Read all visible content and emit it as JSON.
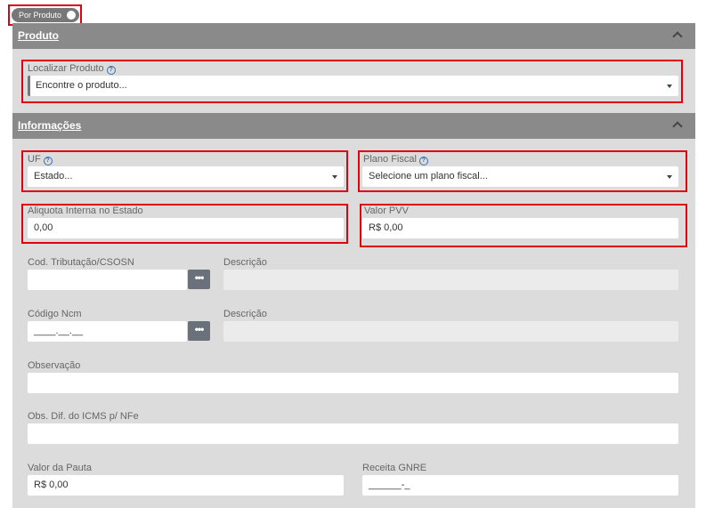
{
  "toggle": {
    "label": "Por Produto"
  },
  "produto": {
    "header": "Produto",
    "localizar_label": "Localizar Produto",
    "localizar_placeholder": "Encontre o produto..."
  },
  "informacoes": {
    "header": "Informações",
    "uf_label": "UF",
    "uf_value": "Estado...",
    "plano_fiscal_label": "Plano Fiscal",
    "plano_fiscal_value": "Selecione um plano fiscal...",
    "aliquota_label": "Aliquota Interna no Estado",
    "aliquota_value": "0,00",
    "valor_pvv_label": "Valor PVV",
    "valor_pvv_value": "R$ 0,00",
    "cod_tributacao_label": "Cod. Tributação/CSOSN",
    "cod_tributacao_value": "",
    "descricao1_label": "Descrição",
    "codigo_ncm_label": "Código Ncm",
    "codigo_ncm_value": "____.__.__",
    "descricao2_label": "Descrição",
    "observacao_label": "Observação",
    "obs_dif_label": "Obs. Dif. do ICMS p/ NFe",
    "valor_pauta_label": "Valor da Pauta",
    "valor_pauta_value": "R$ 0,00",
    "receita_gnre_label": "Receita GNRE",
    "receita_gnre_value": "______-_",
    "dots_label": "•••"
  },
  "icons": {
    "help": "?"
  }
}
